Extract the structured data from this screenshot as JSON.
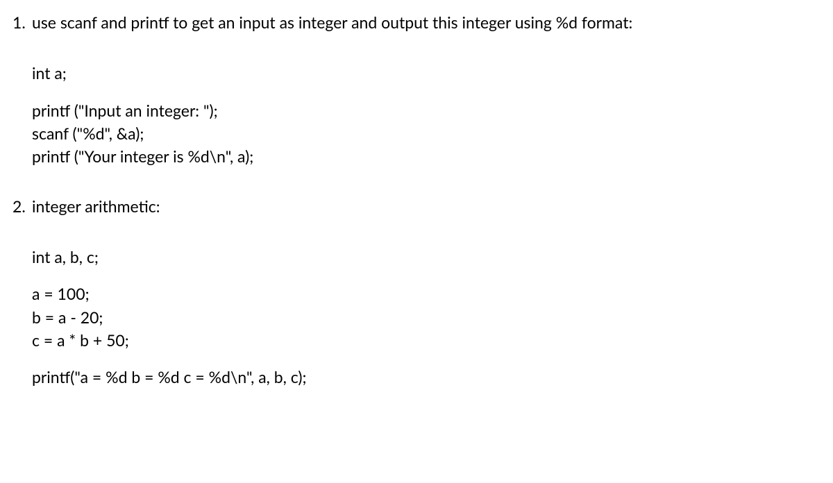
{
  "item1": {
    "number": "1.",
    "title": "use scanf and printf to get an input as integer and output this integer using %d format:",
    "code": {
      "line1": "int a;",
      "line2": "printf (\"Input an integer: \");",
      "line3": "scanf (\"%d\", &a);",
      "line4": "printf (\"Your integer is %d\\n\", a);"
    }
  },
  "item2": {
    "number": "2.",
    "title": "integer arithmetic:",
    "code": {
      "line1": "int a, b, c;",
      "line2": "a = 100;",
      "line3": "b = a - 20;",
      "line4": "c = a * b + 50;",
      "line5": "printf(\"a = %d b = %d c = %d\\n\", a, b, c);"
    }
  }
}
